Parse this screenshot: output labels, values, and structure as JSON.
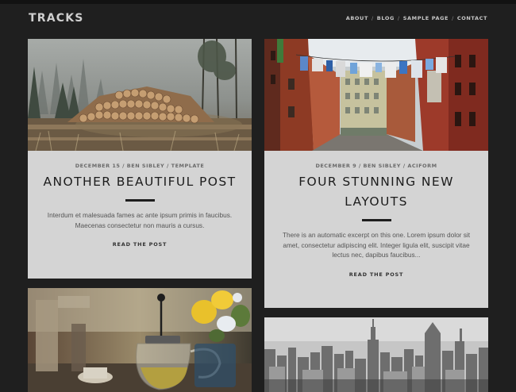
{
  "site": {
    "title": "TRACKS"
  },
  "nav": {
    "items": [
      {
        "label": "ABOUT"
      },
      {
        "label": "BLOG"
      },
      {
        "label": "SAMPLE PAGE"
      },
      {
        "label": "CONTACT"
      }
    ],
    "separator": "/"
  },
  "posts": [
    {
      "photo_icon": "forest-logs-photo",
      "meta": "DECEMBER 15 / BEN SIBLEY / TEMPLATE",
      "title": "ANOTHER BEAUTIFUL POST",
      "excerpt": "Interdum et malesuada fames ac ante ipsum primis in faucibus. Maecenas consectetur non mauris a cursus.",
      "read_more": "READ THE POST"
    },
    {
      "photo_icon": "city-street-laundry-photo",
      "meta": "DECEMBER 9 / BEN SIBLEY / ACIFORM",
      "title_line1": "FOUR STUNNING NEW",
      "title_line2": "LAYOUTS",
      "excerpt": "There is an automatic excerpt on this one. Lorem ipsum dolor sit amet, consectetur adipiscing elit. Integer ligula elit, suscipit vitae lectus nec, dapibus faucibus...",
      "read_more": "READ THE POST"
    },
    {
      "photo_icon": "teapot-flowers-photo"
    },
    {
      "photo_icon": "skyline-photo"
    }
  ],
  "colors": {
    "background": "#1f1f1f",
    "card": "#d4d4d4",
    "header_text": "#cfcfcf"
  }
}
